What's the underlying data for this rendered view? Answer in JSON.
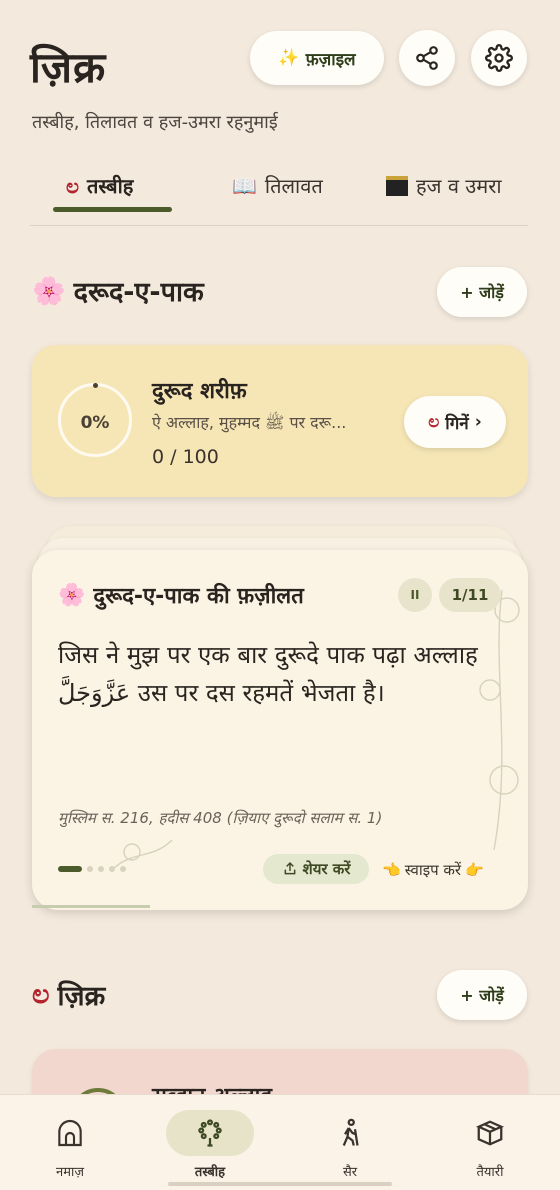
{
  "header": {
    "title": "ज़िक्र",
    "subtitle": "तस्बीह, तिलावत व हज-उमरा रहनुमाई",
    "fazail_label": "फ़ज़ाइल",
    "fazail_icon": "sparkles-icon"
  },
  "tabs": [
    {
      "label": "तस्बीह",
      "icon": "prayer-beads-icon",
      "active": true
    },
    {
      "label": "तिलावत",
      "icon": "open-book-icon",
      "active": false
    },
    {
      "label": "हज व उमरा",
      "icon": "kaaba-icon",
      "active": false
    }
  ],
  "durood_section": {
    "title": "दरूद-ए-पाक",
    "add_label": "+ जोड़ें",
    "card": {
      "progress_label": "0%",
      "progress_fraction": 0,
      "title": "दुरूद शरीफ़",
      "subtitle": "ऐ अल्लाह, मुहम्मद ﷺ पर दरू...",
      "count": "0 / 100",
      "count_button": "गिनें"
    }
  },
  "fazilat_card": {
    "title": "दुरूद-ए-पाक की फ़ज़ीलत",
    "page": "1/11",
    "pause_symbol": "II",
    "text": "जिस ने मुझ पर एक बार दुरूदे पाक पढ़ा अल्लाह عَزَّوَجَلَّ उस पर दस रहमतें भेजता है।",
    "reference": "मुस्लिम स. 216, हदीस 408 (ज़ियाए दुरूदो सलाम स. 1)",
    "share_label": "शेयर करें",
    "swipe_label": "स्वाइप करें",
    "slide_count": 5,
    "active_slide": 0
  },
  "zikr_section": {
    "title": "ज़िक्र",
    "add_label": "+ जोड़ें",
    "peek_title": "सुब्हान अल्लाह"
  },
  "bottom_nav": [
    {
      "label": "नमाज़",
      "icon": "mosque-icon",
      "active": false
    },
    {
      "label": "तस्बीह",
      "icon": "prayer-beads-icon",
      "active": true
    },
    {
      "label": "सैर",
      "icon": "walking-icon",
      "active": false
    },
    {
      "label": "तैयारी",
      "icon": "box-icon",
      "active": false
    }
  ],
  "colors": {
    "background": "#f3e9dd",
    "accent_green": "#4b5b2b",
    "tasbih_card": "#f6e6b6",
    "zikr_card": "#f2d7cf"
  }
}
